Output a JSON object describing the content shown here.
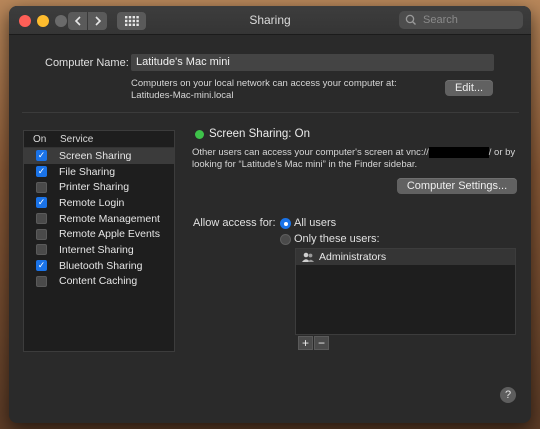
{
  "window": {
    "title": "Sharing"
  },
  "search": {
    "placeholder": "Search"
  },
  "computer": {
    "label": "Computer Name:",
    "name": "Latitude's Mac mini",
    "note_line1": "Computers on your local network can access your computer at:",
    "note_line2": "Latitudes-Mac-mini.local",
    "edit_label": "Edit..."
  },
  "services": {
    "header_on": "On",
    "header_service": "Service",
    "items": [
      {
        "label": "Screen Sharing",
        "checked": true,
        "selected": true
      },
      {
        "label": "File Sharing",
        "checked": true,
        "selected": false
      },
      {
        "label": "Printer Sharing",
        "checked": false,
        "selected": false
      },
      {
        "label": "Remote Login",
        "checked": true,
        "selected": false
      },
      {
        "label": "Remote Management",
        "checked": false,
        "selected": false
      },
      {
        "label": "Remote Apple Events",
        "checked": false,
        "selected": false
      },
      {
        "label": "Internet Sharing",
        "checked": false,
        "selected": false
      },
      {
        "label": "Bluetooth Sharing",
        "checked": true,
        "selected": false
      },
      {
        "label": "Content Caching",
        "checked": false,
        "selected": false
      }
    ]
  },
  "detail": {
    "status": "Screen Sharing: On",
    "desc_part1": "Other users can access your computer's screen at vnc://",
    "desc_part2": "/ or by",
    "desc_line2": "looking for “Latitude's Mac mini” in the Finder sidebar.",
    "computer_settings_label": "Computer Settings...",
    "allow_label": "Allow access for:",
    "all_users_label": "All users",
    "only_users_label": "Only these users:",
    "users": [
      "Administrators"
    ],
    "add_label": "+",
    "remove_label": "−"
  },
  "help_label": "?",
  "colors": {
    "accent": "#1a73e8",
    "status_on": "#3ec24a"
  }
}
